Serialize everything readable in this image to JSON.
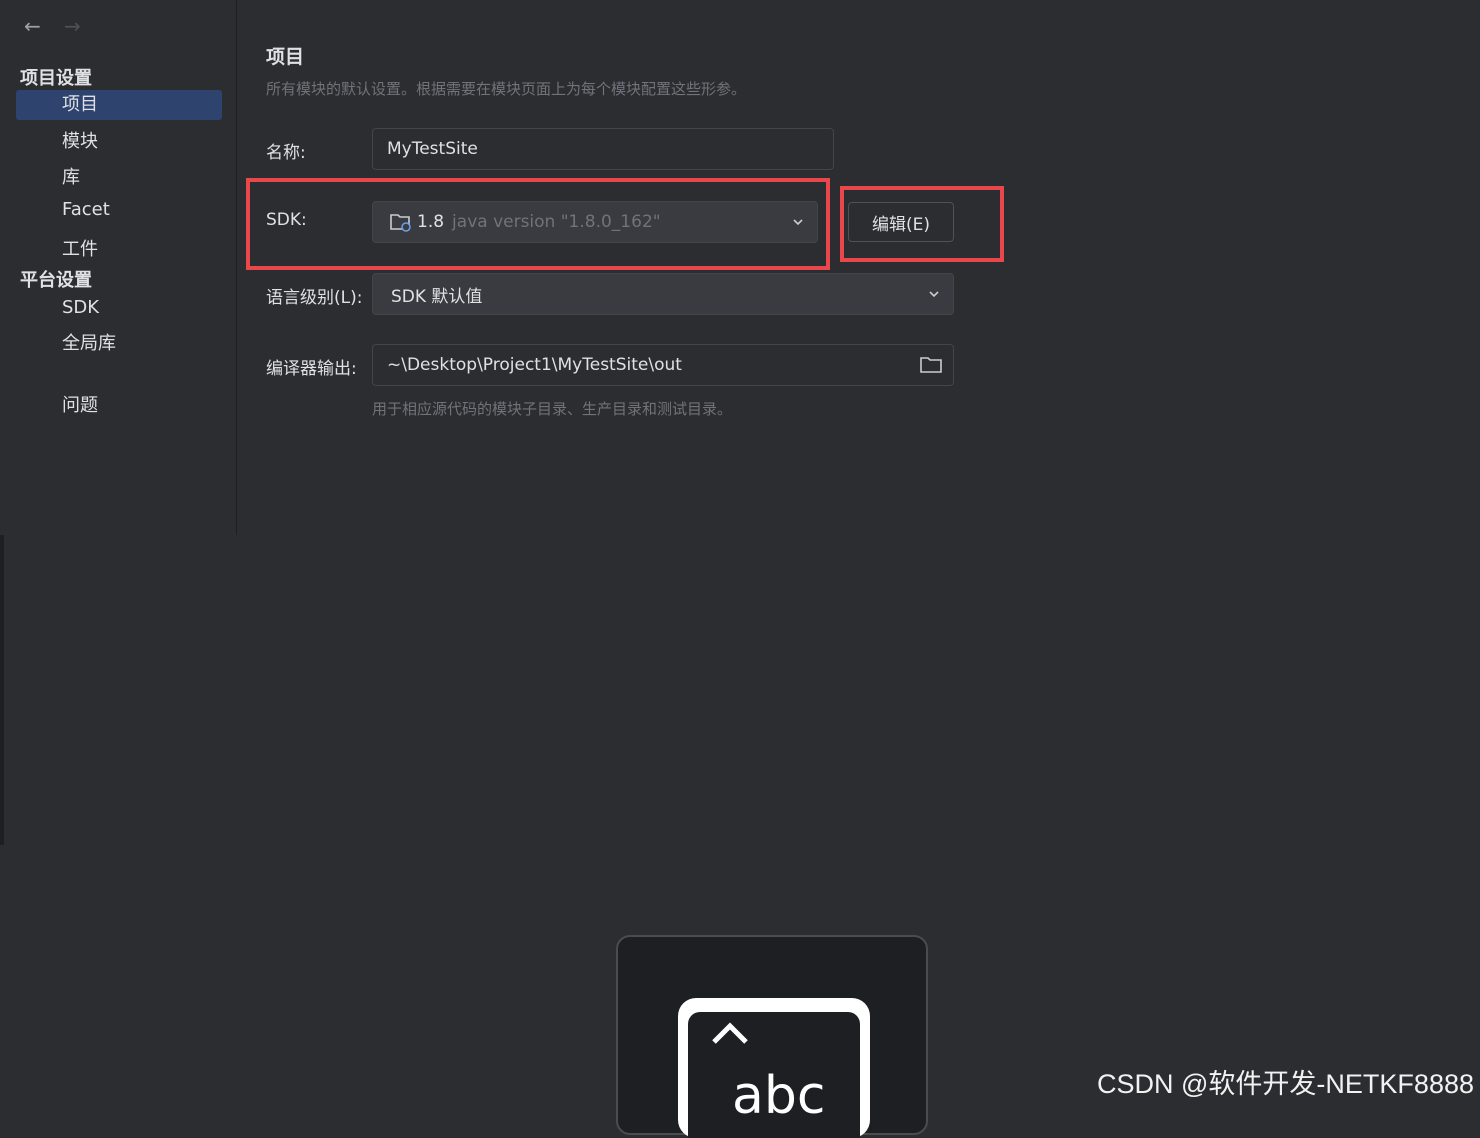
{
  "sidebar": {
    "nav_back": "←",
    "nav_forward": "→",
    "project_settings_header": "项目设置",
    "project_items": [
      "项目",
      "模块",
      "库",
      "Facet",
      "工件"
    ],
    "platform_settings_header": "平台设置",
    "platform_items": [
      "SDK",
      "全局库"
    ],
    "problems": "问题",
    "selected_color": "#2e436e"
  },
  "main": {
    "title": "项目",
    "description": "所有模块的默认设置。根据需要在模块页面上为每个模块配置这些形参。",
    "name_label": "名称:",
    "name_value": "MyTestSite",
    "sdk_label": "SDK:",
    "sdk_value": "1.8",
    "sdk_version": "java version \"1.8.0_162\"",
    "edit_button": "编辑(E)",
    "language_level_label": "语言级别(L):",
    "language_level_value": "SDK 默认值",
    "compiler_output_label": "编译器输出:",
    "compiler_output_value": "~\\Desktop\\Project1\\MyTestSite\\out",
    "compiler_output_hint": "用于相应源代码的模块子目录、生产目录和测试目录。"
  },
  "overlay": {
    "key_label": "abc",
    "key_symbol": "^"
  },
  "watermark": "CSDN @软件开发-NETKF8888",
  "colors": {
    "highlight": "#e8474b",
    "background": "#2b2d30"
  }
}
